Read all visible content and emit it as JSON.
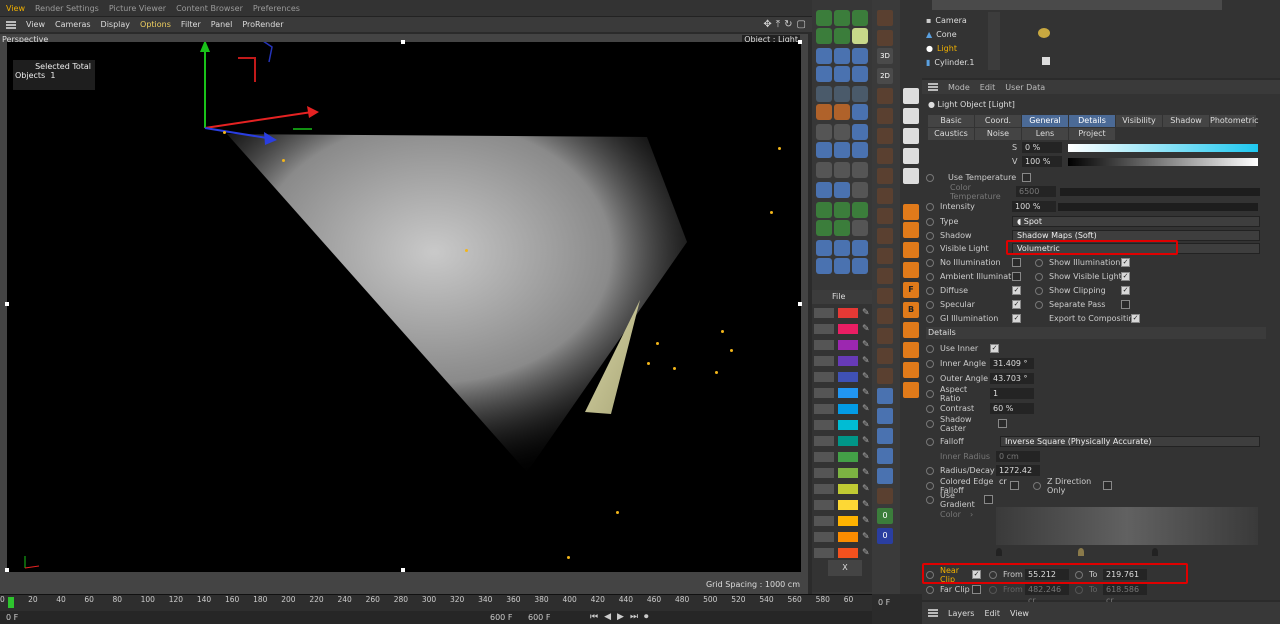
{
  "topmenu": [
    "View",
    "Render Settings",
    "Picture Viewer",
    "Content Browser",
    "Preferences"
  ],
  "vpmenu": [
    "View",
    "Cameras",
    "Display",
    "Options",
    "Filter",
    "Panel",
    "ProRender"
  ],
  "viewport": {
    "label": "Perspective",
    "object_label": "Object : Light",
    "hud_selected": "Selected Total",
    "hud_objects": "Objects",
    "hud_count": "1",
    "grid_spacing": "Grid Spacing : 1000 cm"
  },
  "timeline": {
    "ticks": [
      "0",
      "20",
      "40",
      "60",
      "80",
      "100",
      "120",
      "140",
      "160",
      "180",
      "200",
      "220",
      "240",
      "260",
      "280",
      "300",
      "320",
      "340",
      "360",
      "380",
      "400",
      "420",
      "440",
      "460",
      "480",
      "500",
      "520",
      "540",
      "560",
      "580",
      "60"
    ],
    "frame": "0 F",
    "start": "0 F",
    "end": "600 F",
    "end2": "600 F"
  },
  "materials": {
    "header": "File",
    "close": "X",
    "colors": [
      "#e53935",
      "#e91e63",
      "#9c27b0",
      "#673ab7",
      "#3f51b5",
      "#2196f3",
      "#039be5",
      "#00bcd4",
      "#009688",
      "#43a047",
      "#7cb342",
      "#c0ca33",
      "#fdd835",
      "#ffb300",
      "#fb8c00",
      "#f4511e"
    ]
  },
  "objects": [
    {
      "name": "Camera",
      "active": false
    },
    {
      "name": "Cone",
      "active": false
    },
    {
      "name": "Light",
      "active": true
    },
    {
      "name": "Cylinder.1",
      "active": false
    }
  ],
  "attr": {
    "menu": [
      "Mode",
      "Edit",
      "User Data"
    ],
    "title": "Light Object [Light]",
    "tabs1": [
      "Basic",
      "Coord.",
      "General",
      "Details",
      "Visibility",
      "Shadow",
      "Photometric"
    ],
    "tabs2": [
      "Caustics",
      "Noise",
      "Lens",
      "Project"
    ],
    "s_label": "S",
    "s_value": "0 %",
    "v_label": "V",
    "v_value": "100 %",
    "use_temperature": "Use Temperature",
    "color_temperature": "Color Temperature",
    "color_temperature_value": "6500",
    "intensity": "Intensity",
    "intensity_value": "100 %",
    "type": "Type",
    "type_value": "Spot",
    "shadow": "Shadow",
    "shadow_value": "Shadow Maps (Soft)",
    "visible_light": "Visible Light",
    "visible_light_value": "Volumetric",
    "no_illumination": "No Illumination",
    "show_illumination": "Show Illumination",
    "ambient_illumination": "Ambient Illumination",
    "show_visible_light": "Show Visible Light",
    "diffuse": "Diffuse",
    "show_clipping": "Show Clipping",
    "specular": "Specular",
    "separate_pass": "Separate Pass",
    "gi_illumination": "GI Illumination",
    "export_to_compositing": "Export to Compositing",
    "details": "Details",
    "use_inner": "Use Inner",
    "inner_angle": "Inner Angle",
    "inner_angle_value": "31.409 °",
    "outer_angle": "Outer Angle",
    "outer_angle_value": "43.703 °",
    "aspect_ratio": "Aspect Ratio",
    "aspect_ratio_value": "1",
    "contrast": "Contrast",
    "contrast_value": "60 %",
    "shadow_caster": "Shadow Caster",
    "falloff": "Falloff",
    "falloff_value": "Inverse Square (Physically Accurate)",
    "inner_radius": "Inner Radius",
    "inner_radius_value": "0 cm",
    "radius_decay": "Radius/Decay",
    "radius_decay_value": "1272.42 cr",
    "colored_edge_falloff": "Colored Edge Falloff",
    "z_direction_only": "Z Direction Only",
    "use_gradient": "Use Gradient",
    "color": "Color",
    "near_clip": "Near Clip",
    "near_from": "From",
    "near_from_value": "55.212 cm",
    "near_to": "To",
    "near_to_value": "219.761 cr",
    "far_clip": "Far Clip",
    "far_from": "From",
    "far_from_value": "482.246 cr",
    "far_to": "To",
    "far_to_value": "618.586 cr"
  },
  "layers": [
    "Layers",
    "Edit",
    "View"
  ],
  "accent": "#f0b000"
}
